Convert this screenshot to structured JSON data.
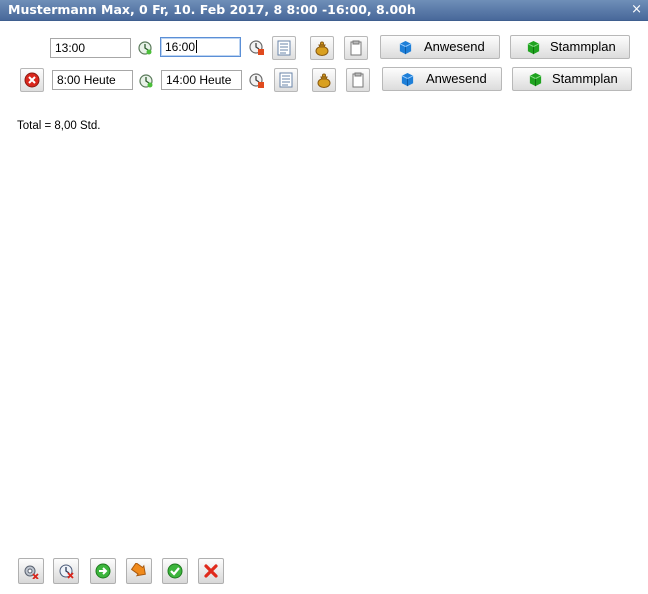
{
  "window": {
    "title": "Mustermann Max, 0 Fr, 10. Feb 2017, 8 8:00 -16:00, 8.00h",
    "close_glyph": "×"
  },
  "rows": [
    {
      "start": "13:00",
      "end": "16:00",
      "anwesend": "Anwesend",
      "stammplan": "Stammplan"
    },
    {
      "start": "8:00 Heute",
      "end": "14:00 Heute",
      "anwesend": "Anwesend",
      "stammplan": "Stammplan"
    }
  ],
  "total": "Total = 8,00 Std.",
  "icons": {
    "delete_row": "delete-icon",
    "clock_start": "clock-icon",
    "clock_end": "clock-stop-icon",
    "list": "list-icon",
    "money": "money-bag-icon",
    "note": "note-icon",
    "cube_blue": "blue-cube-icon",
    "cube_green": "green-cube-icon"
  },
  "colors": {
    "title_bar": "#4f6f9f",
    "blue_cube": "#1e7fd8",
    "green_cube": "#1fa31f",
    "delete_red": "#d9261c"
  }
}
